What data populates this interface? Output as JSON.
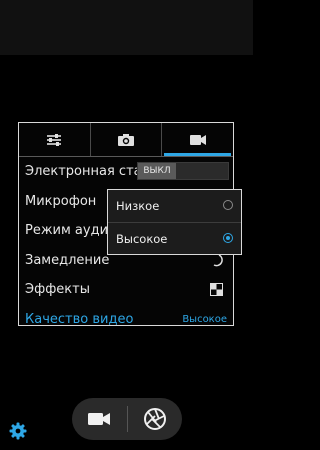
{
  "tabs": [
    {
      "icon": "sliders-icon",
      "active": false
    },
    {
      "icon": "camera-icon",
      "active": false
    },
    {
      "icon": "video-camera-icon",
      "active": true
    }
  ],
  "settings": {
    "rows": [
      {
        "label": "Электронная стабилизация",
        "toggle_value": "ВЫКЛ"
      },
      {
        "label": "Микрофон"
      },
      {
        "label": "Режим аудио"
      },
      {
        "label": "Замедление",
        "icon": "slow-motion-icon"
      },
      {
        "label": "Эффекты",
        "icon": "effects-icon"
      },
      {
        "label": "Качество видео",
        "value": "Высокое"
      }
    ]
  },
  "popup": {
    "options": [
      {
        "label": "Низкое",
        "selected": false
      },
      {
        "label": "Высокое",
        "selected": true
      }
    ]
  },
  "bottom_bar": {
    "mode_icon": "video-camera-icon",
    "shutter_icon": "shutter-icon"
  },
  "settings_gear_icon": "gear-icon",
  "colors": {
    "accent": "#2ea7e6",
    "panel_border": "#d9d9d9"
  }
}
